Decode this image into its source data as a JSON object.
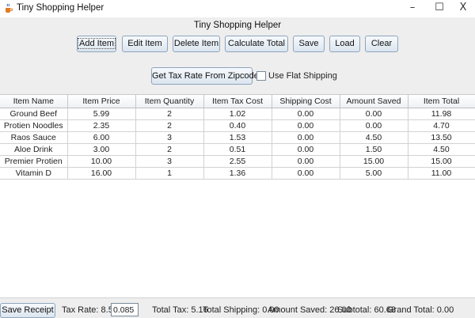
{
  "window": {
    "title": "Tiny Shopping Helper",
    "min_glyph": "–",
    "max_glyph": "☐",
    "close_glyph": "X"
  },
  "header": {
    "title": "Tiny Shopping Helper"
  },
  "toolbar": {
    "add_item": "Add Item",
    "edit_item": "Edit Item",
    "delete_item": "Delete Item",
    "calculate_total": "Calculate Total",
    "save": "Save",
    "load": "Load",
    "clear": "Clear"
  },
  "tax_row": {
    "zip_button": "Get Tax Rate From Zipcode",
    "flat_shipping_label": "Use Flat Shipping",
    "flat_shipping_checked": false
  },
  "table": {
    "columns": [
      "Item Name",
      "Item Price",
      "Item Quantity",
      "Item Tax Cost",
      "Shipping Cost",
      "Amount Saved",
      "Item Total"
    ],
    "rows": [
      [
        "Ground Beef",
        "5.99",
        "2",
        "1.02",
        "0.00",
        "0.00",
        "11.98"
      ],
      [
        "Protien Noodles",
        "2.35",
        "2",
        "0.40",
        "0.00",
        "0.00",
        "4.70"
      ],
      [
        "Raos Sauce",
        "6.00",
        "3",
        "1.53",
        "0.00",
        "4.50",
        "13.50"
      ],
      [
        "Aloe Drink",
        "3.00",
        "2",
        "0.51",
        "0.00",
        "1.50",
        "4.50"
      ],
      [
        "Premier Protien",
        "10.00",
        "3",
        "2.55",
        "0.00",
        "15.00",
        "15.00"
      ],
      [
        "Vitamin D",
        "16.00",
        "1",
        "1.36",
        "0.00",
        "5.00",
        "11.00"
      ]
    ]
  },
  "footer": {
    "save_receipt": "Save Receipt",
    "tax_rate_label": "Tax Rate: 8.5%",
    "tax_rate_value": "0.085",
    "total_tax": "Total Tax: 5.16",
    "total_shipping": "Total Shipping: 0.00",
    "amount_saved": "Amount Saved: 26.00",
    "subtotal": "Subtotal: 60.68",
    "grand_total": "Grand Total: 0.00"
  }
}
